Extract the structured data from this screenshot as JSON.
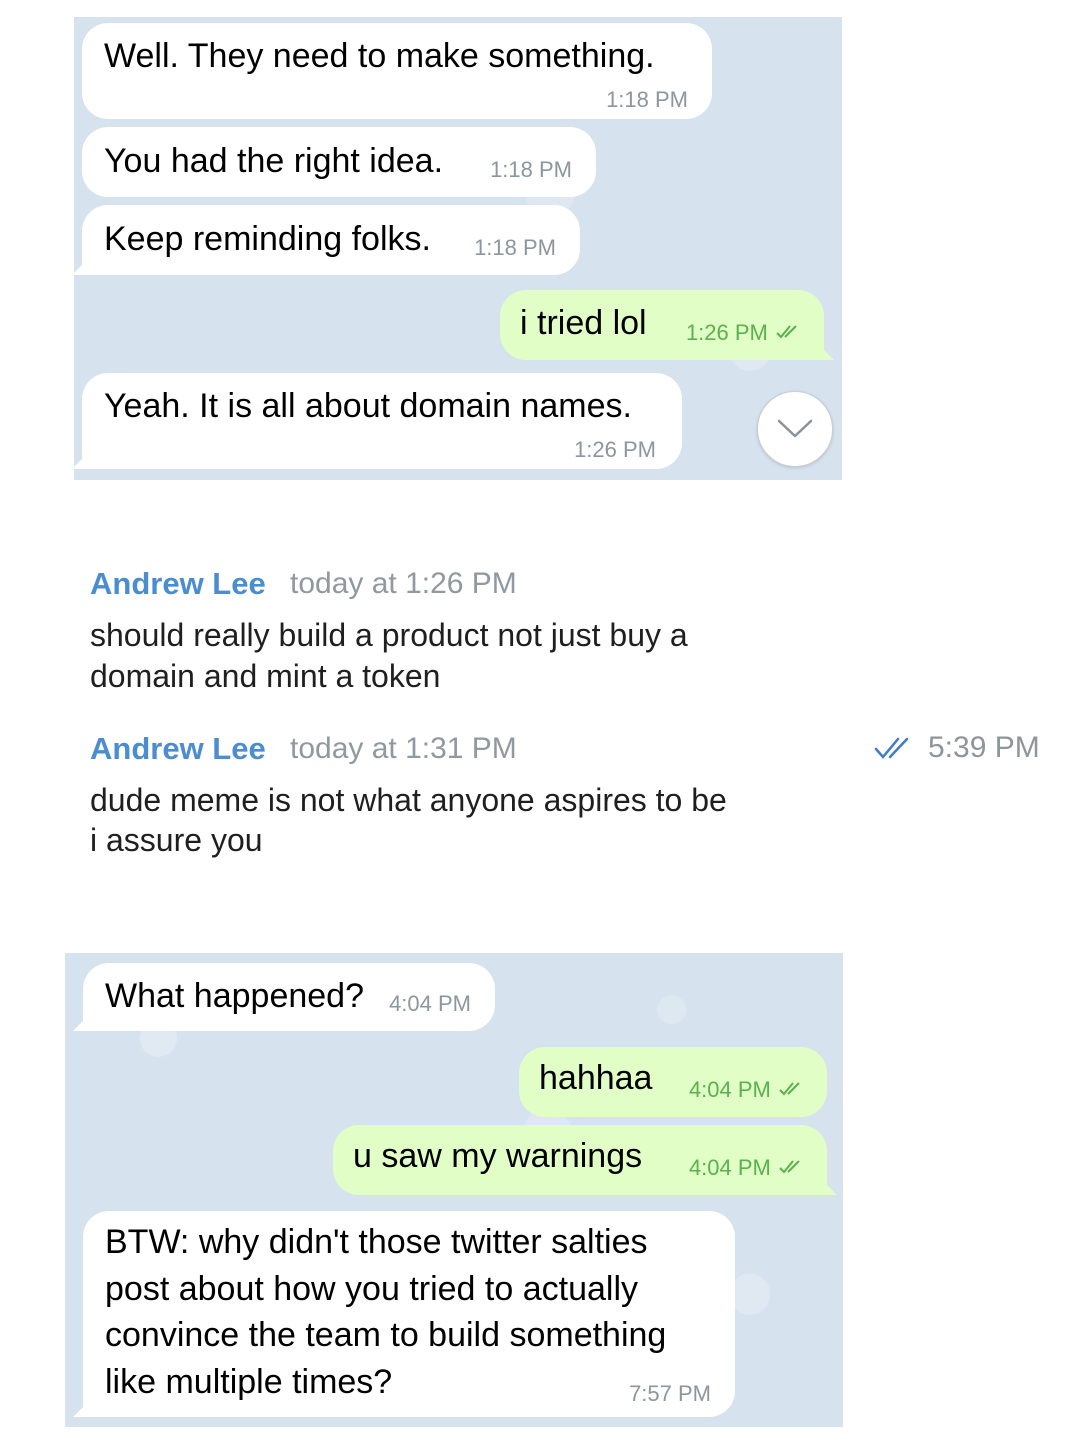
{
  "top_chat": {
    "messages": [
      {
        "text": "Well. They need to make something.",
        "time": "1:18 PM"
      },
      {
        "text": "You had the right idea.",
        "time": "1:18 PM"
      },
      {
        "text": "Keep reminding folks.",
        "time": "1:18 PM"
      },
      {
        "text": "i tried lol",
        "time": "1:26 PM"
      },
      {
        "text": "Yeah. It is all about domain names.",
        "time": "1:26 PM"
      }
    ]
  },
  "posts": [
    {
      "author": "Andrew Lee",
      "timestamp": "today at 1:26 PM",
      "lines": [
        "should really build a product not just buy a",
        "domain and mint a token"
      ]
    },
    {
      "author": "Andrew Lee",
      "timestamp": "today at 1:31 PM",
      "lines": [
        "dude meme is not what anyone aspires to be",
        "i assure you"
      ]
    }
  ],
  "side_status": {
    "time": "5:39 PM"
  },
  "bottom_chat": {
    "messages": [
      {
        "text": "What happened?",
        "time": "4:04 PM"
      },
      {
        "text": "hahhaa",
        "time": "4:04 PM"
      },
      {
        "text": "u saw my warnings",
        "time": "4:04 PM"
      },
      {
        "lines": [
          "BTW: why didn't those twitter salties",
          "post about how you tried to actually",
          "convince the team to build something",
          "like multiple times?"
        ],
        "time": "7:57 PM"
      }
    ]
  },
  "colors": {
    "incoming_bubble": "#ffffff",
    "outgoing_bubble": "#e1fec6",
    "author_name": "#4a8dd0",
    "read_check": "#5bb14e"
  }
}
